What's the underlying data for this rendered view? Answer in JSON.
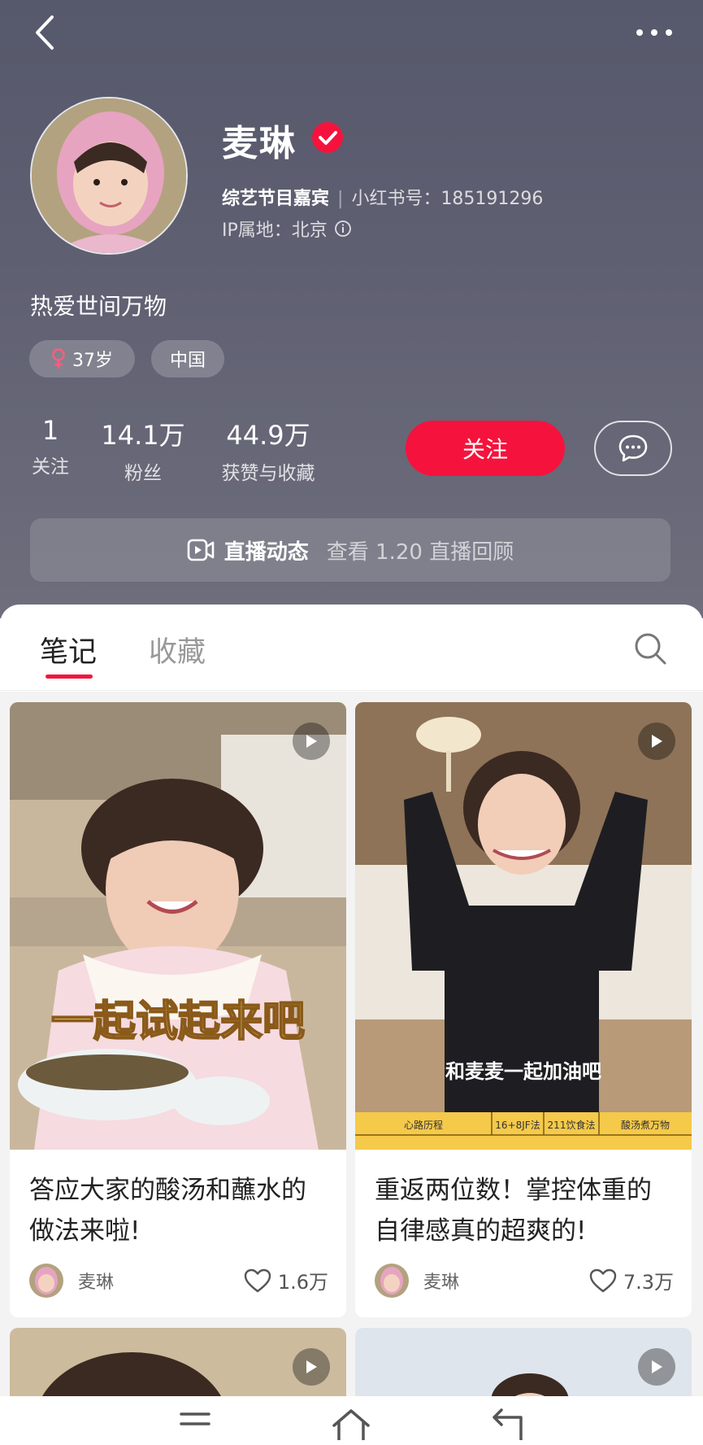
{
  "header": {
    "name": "麦琳",
    "role": "综艺节目嘉宾",
    "id_label": "小红书号：185191296",
    "ip_label": "IP属地：北京",
    "bio": "热爱世间万物",
    "tags": {
      "age": "37岁",
      "region": "中国"
    },
    "stats": [
      {
        "num": "1",
        "label": "关注"
      },
      {
        "num": "14.1万",
        "label": "粉丝"
      },
      {
        "num": "44.9万",
        "label": "获赞与收藏"
      }
    ],
    "follow_label": "关注",
    "live": {
      "title": "直播动态",
      "subtitle": "查看 1.20 直播回顾"
    }
  },
  "tabs": {
    "notes": "笔记",
    "favorites": "收藏"
  },
  "cards": [
    {
      "overlay_text": "一起试起来吧",
      "title": "答应大家的酸汤和蘸水的做法来啦!",
      "author": "麦琳",
      "likes": "1.6万"
    },
    {
      "overlay_text": "和麦麦一起加油吧",
      "table_cells": [
        "心路历程",
        "16+8JF法",
        "211饮食法",
        "酸汤煮万物"
      ],
      "title": "重返两位数！掌控体重的自律感真的超爽的!",
      "author": "麦琳",
      "likes": "7.3万"
    }
  ],
  "colors": {
    "accent": "#f5133d",
    "header_bg": "#5c5d6f"
  }
}
